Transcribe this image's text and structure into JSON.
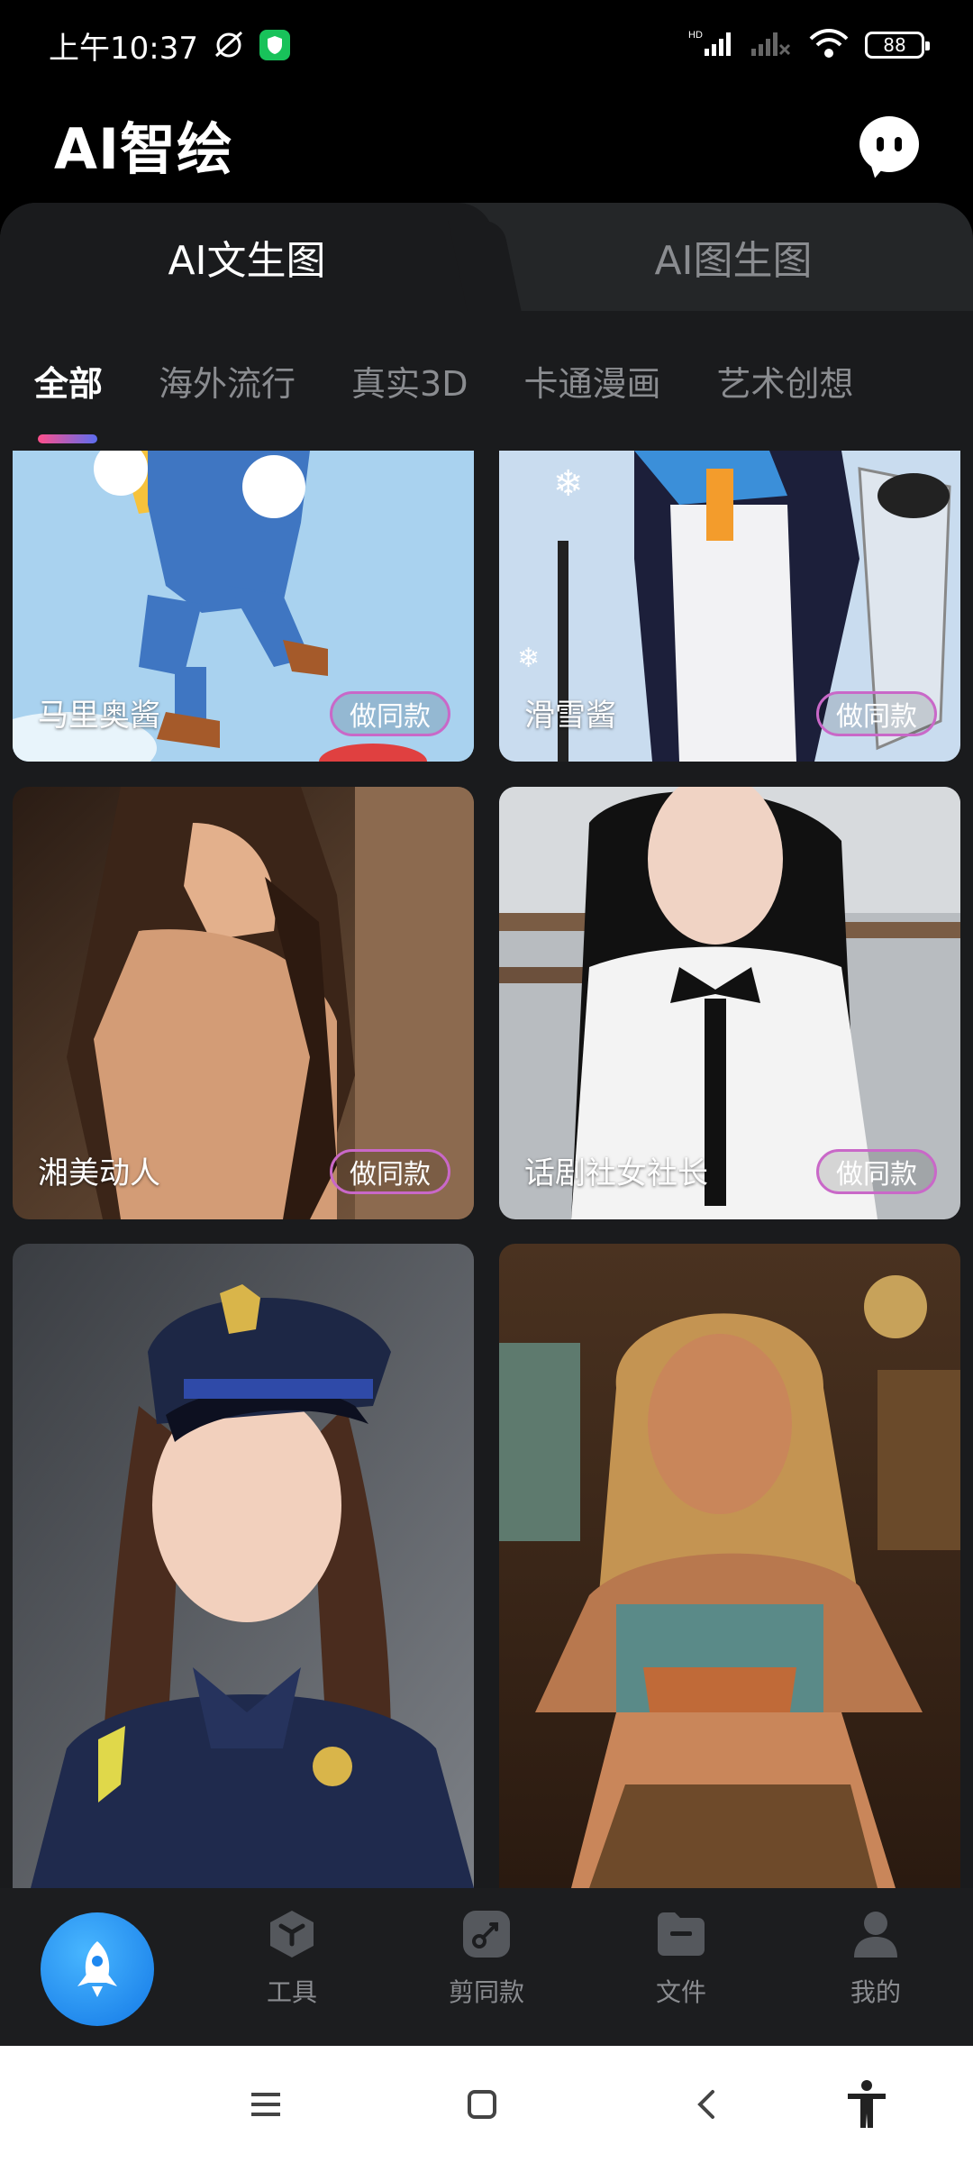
{
  "status_bar": {
    "time": "上午10:37",
    "battery": "88",
    "network": "HD"
  },
  "app": {
    "title": "AI智绘"
  },
  "mode_tabs": [
    {
      "label": "AI文生图",
      "active": true
    },
    {
      "label": "AI图生图",
      "active": false
    }
  ],
  "categories": [
    {
      "label": "全部",
      "active": true
    },
    {
      "label": "海外流行",
      "active": false
    },
    {
      "label": "真实3D",
      "active": false
    },
    {
      "label": "卡通漫画",
      "active": false
    },
    {
      "label": "艺术创想",
      "active": false
    }
  ],
  "cards": [
    {
      "title": "马里奥酱",
      "button": "做同款"
    },
    {
      "title": "滑雪酱",
      "button": "做同款"
    },
    {
      "title": "湘美动人",
      "button": "做同款"
    },
    {
      "title": "话剧社女社长",
      "button": "做同款"
    },
    {
      "title": "",
      "button": ""
    },
    {
      "title": "",
      "button": ""
    }
  ],
  "bottom_nav": [
    {
      "label": "",
      "icon": "rocket-icon",
      "active": true
    },
    {
      "label": "工具",
      "icon": "cube-icon"
    },
    {
      "label": "剪同款",
      "icon": "scissors-icon"
    },
    {
      "label": "文件",
      "icon": "folder-icon"
    },
    {
      "label": "我的",
      "icon": "person-icon"
    }
  ],
  "colors": {
    "accent": "#1e88f0",
    "background": "#1a1b1d",
    "tab_indicator_start": "#ff4f8b",
    "tab_indicator_end": "#5b6df0"
  }
}
